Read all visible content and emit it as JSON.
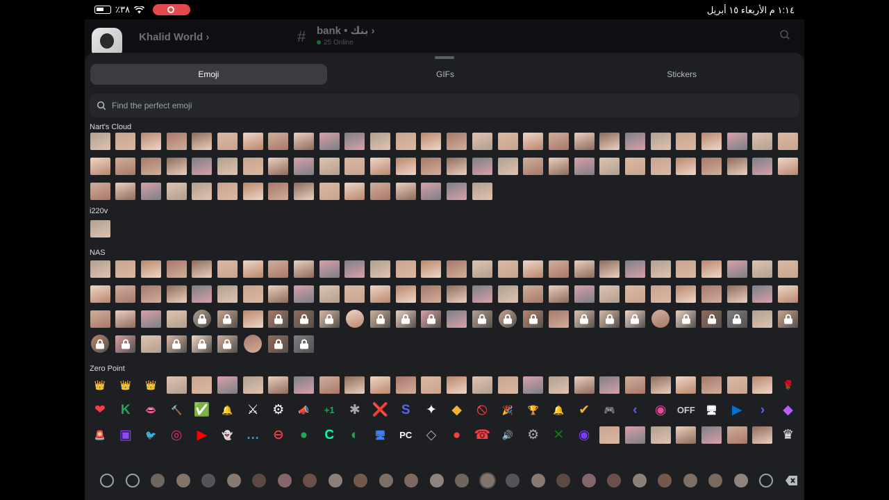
{
  "status_bar": {
    "battery": "٪٣٨",
    "datetime": "١:١٤ م   الأربعاء ١٥ أبريل"
  },
  "header": {
    "server_name": "Khalid World",
    "channel_name": "bank • بنك",
    "online": "25 Online"
  },
  "picker": {
    "tabs": [
      {
        "label": "Emoji",
        "active": true
      },
      {
        "label": "GIFs",
        "active": false
      },
      {
        "label": "Stickers",
        "active": false
      }
    ],
    "search_placeholder": "Find the perfect emoji",
    "sections": [
      {
        "title": "Nart's Cloud",
        "count": 72
      },
      {
        "title": "i220v",
        "count": 1
      },
      {
        "title": "NAS",
        "count": 93
      },
      {
        "title": "Zero Point",
        "count": 84
      }
    ]
  },
  "colors": {
    "accent_red": "#e5484d",
    "online_green": "#23a55a",
    "sheet_bg": "#1e1f22"
  },
  "icons": [
    "search-icon",
    "lock-icon",
    "clock-icon",
    "trophy-icon",
    "smiley-icon",
    "backspace-icon",
    "chevron-right-icon"
  ]
}
